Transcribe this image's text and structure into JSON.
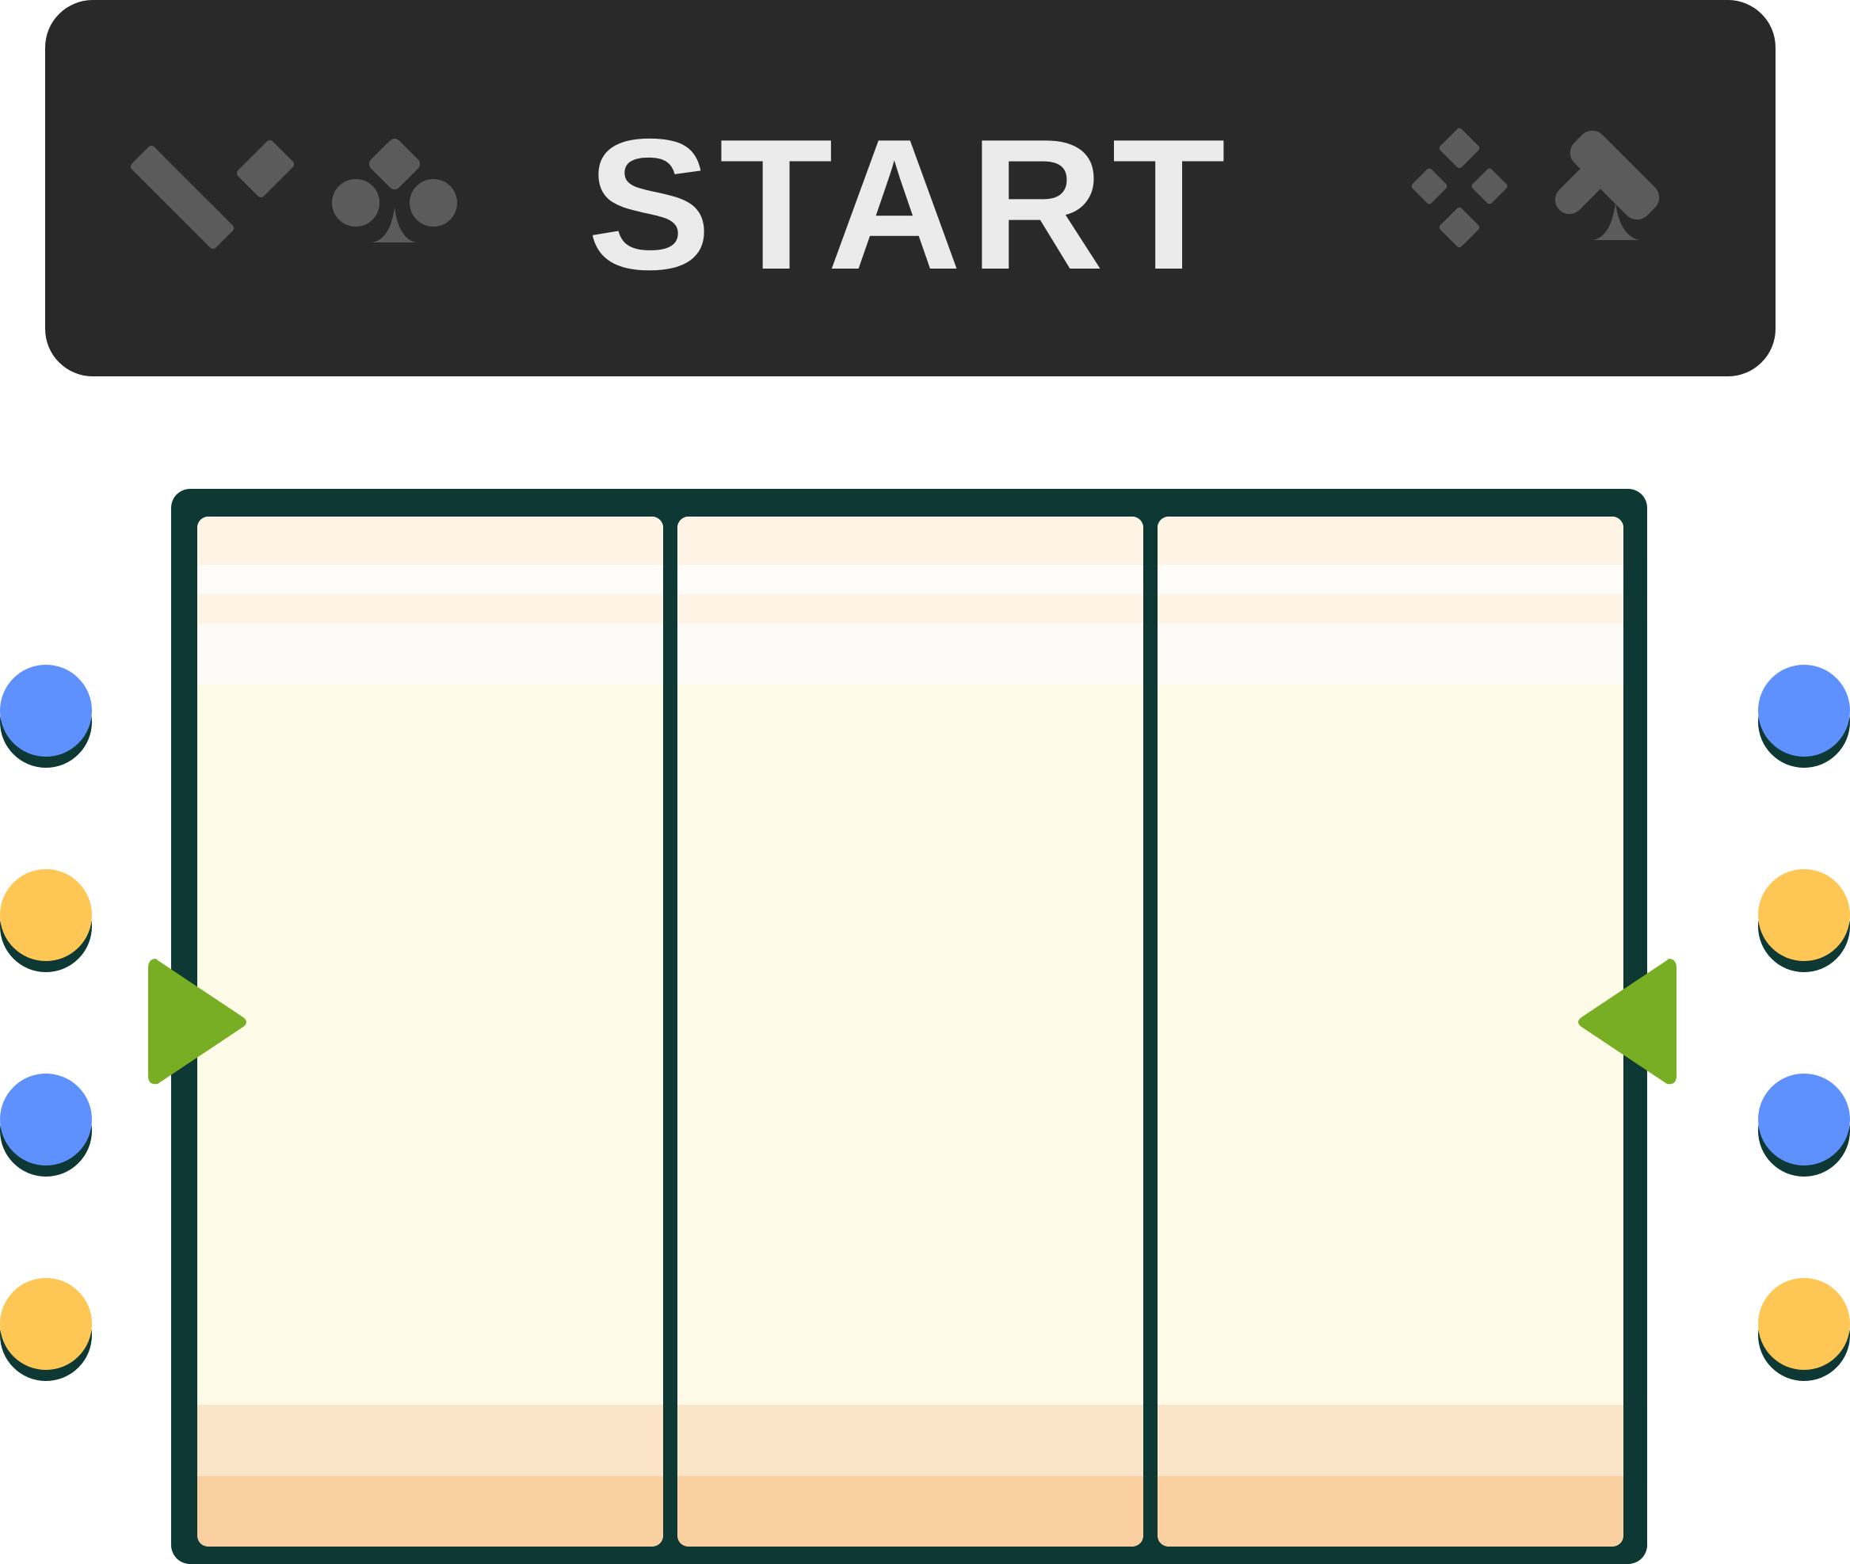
{
  "banner": {
    "label": "START",
    "background": "#292929",
    "text_color": "#ebebeb",
    "suit_color": "#5b5b5b",
    "left_icons": [
      "heart-icon",
      "club-icon"
    ],
    "right_icons": [
      "diamond-icon",
      "spade-icon"
    ]
  },
  "board": {
    "frame_color": "#0d3833",
    "lanes": [
      {
        "name": "lane-1"
      },
      {
        "name": "lane-2"
      },
      {
        "name": "lane-3"
      }
    ],
    "lane_colors": {
      "top": "#fdf4e6",
      "middle": "#fdfbe8",
      "bottom_light": "#fae5c9",
      "bottom_dark": "#fad0a0"
    }
  },
  "arrows": {
    "color": "#77ae23",
    "left": "arrow-right-icon",
    "right": "arrow-left-icon"
  },
  "side_tokens": {
    "left": [
      "blue",
      "yellow",
      "blue",
      "yellow"
    ],
    "right": [
      "blue",
      "yellow",
      "blue",
      "yellow"
    ],
    "colors": {
      "blue": "#5f91fe",
      "yellow": "#fec655"
    }
  }
}
